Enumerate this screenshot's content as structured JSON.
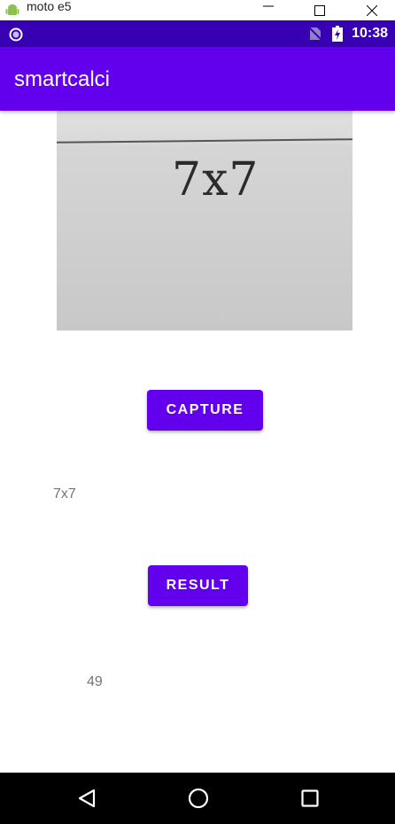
{
  "window": {
    "title": "moto e5",
    "icon": "android-icon",
    "controls": [
      "minimize-icon",
      "maximize-icon",
      "close-icon"
    ]
  },
  "status_bar": {
    "time": "10:38",
    "icons": [
      "notification-dot-icon",
      "no-sim-icon",
      "battery-charging-icon"
    ]
  },
  "app_bar": {
    "title": "smartcalci"
  },
  "captured_image": {
    "handwritten_text": "7x7"
  },
  "buttons": {
    "capture_label": "CAPTURE",
    "result_label": "RESULT"
  },
  "recognized_text": "7x7",
  "result_value": "49",
  "nav_bar": {
    "icons": [
      "back-icon",
      "home-icon",
      "recents-icon"
    ]
  },
  "colors": {
    "primary": "#6200ee",
    "primary_dark": "#3700b3",
    "secondary_text": "#757575"
  }
}
